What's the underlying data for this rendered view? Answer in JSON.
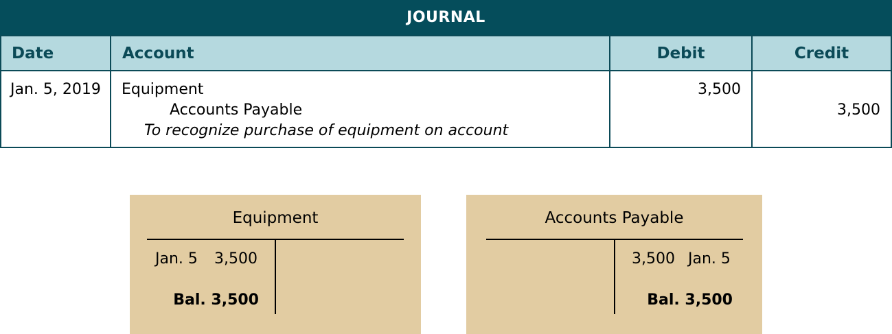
{
  "journal": {
    "title": "JOURNAL",
    "headers": {
      "date": "Date",
      "account": "Account",
      "debit": "Debit",
      "credit": "Credit"
    },
    "entry": {
      "date": "Jan. 5, 2019",
      "debit_account": "Equipment",
      "credit_account": "Accounts Payable",
      "description": "To recognize purchase of equipment on account",
      "debit_amount": "3,500",
      "credit_amount": "3,500"
    }
  },
  "t_accounts": [
    {
      "name": "Equipment",
      "debit_entry_date": "Jan. 5",
      "debit_entry_amount": "3,500",
      "balance": "Bal. 3,500"
    },
    {
      "name": "Accounts Payable",
      "credit_entry_amount": "3,500",
      "credit_entry_date": "Jan. 5",
      "balance": "Bal. 3,500"
    }
  ],
  "colors": {
    "title_bar": "#054d5b",
    "header_bg": "#b5d9df",
    "header_text": "#0b4a57",
    "t_account_bg": "#e2cca2"
  }
}
